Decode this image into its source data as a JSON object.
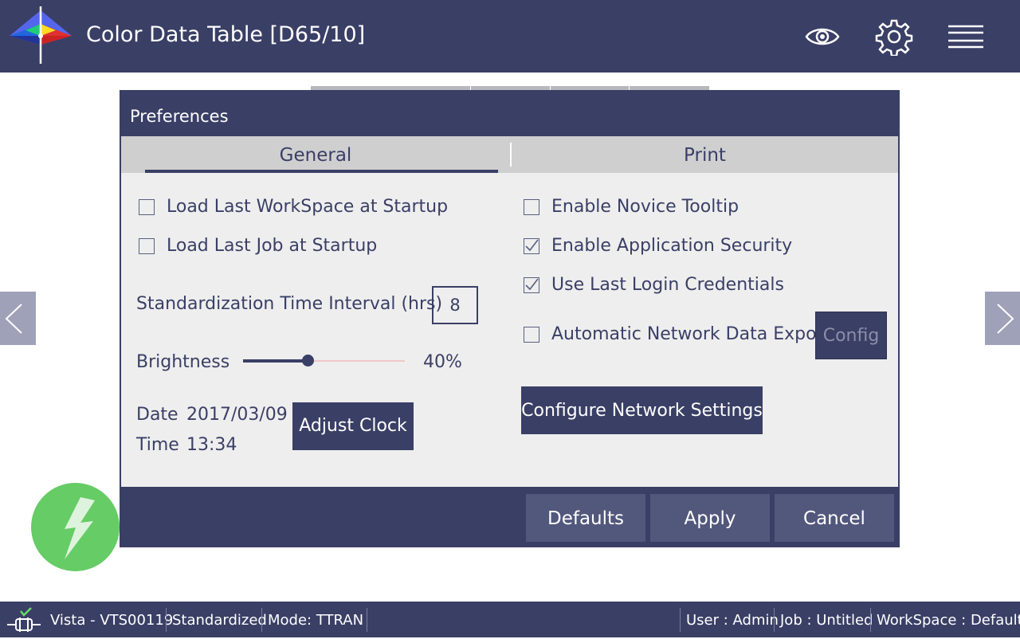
{
  "header": {
    "title": "Color Data Table [D65/10]",
    "icons": [
      "eye-icon",
      "gear-icon",
      "hamburger-menu-icon"
    ]
  },
  "dialog": {
    "title": "Preferences",
    "tabs": [
      {
        "label": "General",
        "active": true
      },
      {
        "label": "Print",
        "active": false
      }
    ],
    "general": {
      "load_workspace": {
        "label": "Load Last WorkSpace at Startup",
        "checked": false
      },
      "load_job": {
        "label": "Load Last Job at Startup",
        "checked": false
      },
      "interval": {
        "label": "Standardization Time Interval (hrs)",
        "value": "8"
      },
      "brightness": {
        "label": "Brightness",
        "value_text": "40%",
        "fraction": 0.4
      },
      "date": {
        "label": "Date",
        "value": "2017/03/09"
      },
      "time": {
        "label": "Time",
        "value": "13:34"
      },
      "adjust_clock_label": "Adjust Clock",
      "novice_tooltip": {
        "label": "Enable Novice Tooltip",
        "checked": false
      },
      "app_security": {
        "label": "Enable Application Security",
        "checked": true
      },
      "last_login": {
        "label": "Use Last Login Credentials",
        "checked": true
      },
      "network_export": {
        "label": "Automatic Network Data Export",
        "checked": false
      },
      "config_label": "Config",
      "configure_network_label": "Configure Network Settings"
    },
    "footer": {
      "defaults": "Defaults",
      "apply": "Apply",
      "cancel": "Cancel"
    }
  },
  "statusbar": {
    "device": "Vista - VTS00119",
    "state": "Standardized",
    "mode": "Mode:  TTRAN",
    "user": "User :  Admin",
    "job": "Job :  Untitled",
    "workspace": "WorkSpace :  Default"
  },
  "colors": {
    "primary": "#3a3f66",
    "panel": "#eeeeee",
    "tabbar": "#cfcfcf",
    "fab": "#66cc66",
    "footer_button": "#52577c"
  }
}
